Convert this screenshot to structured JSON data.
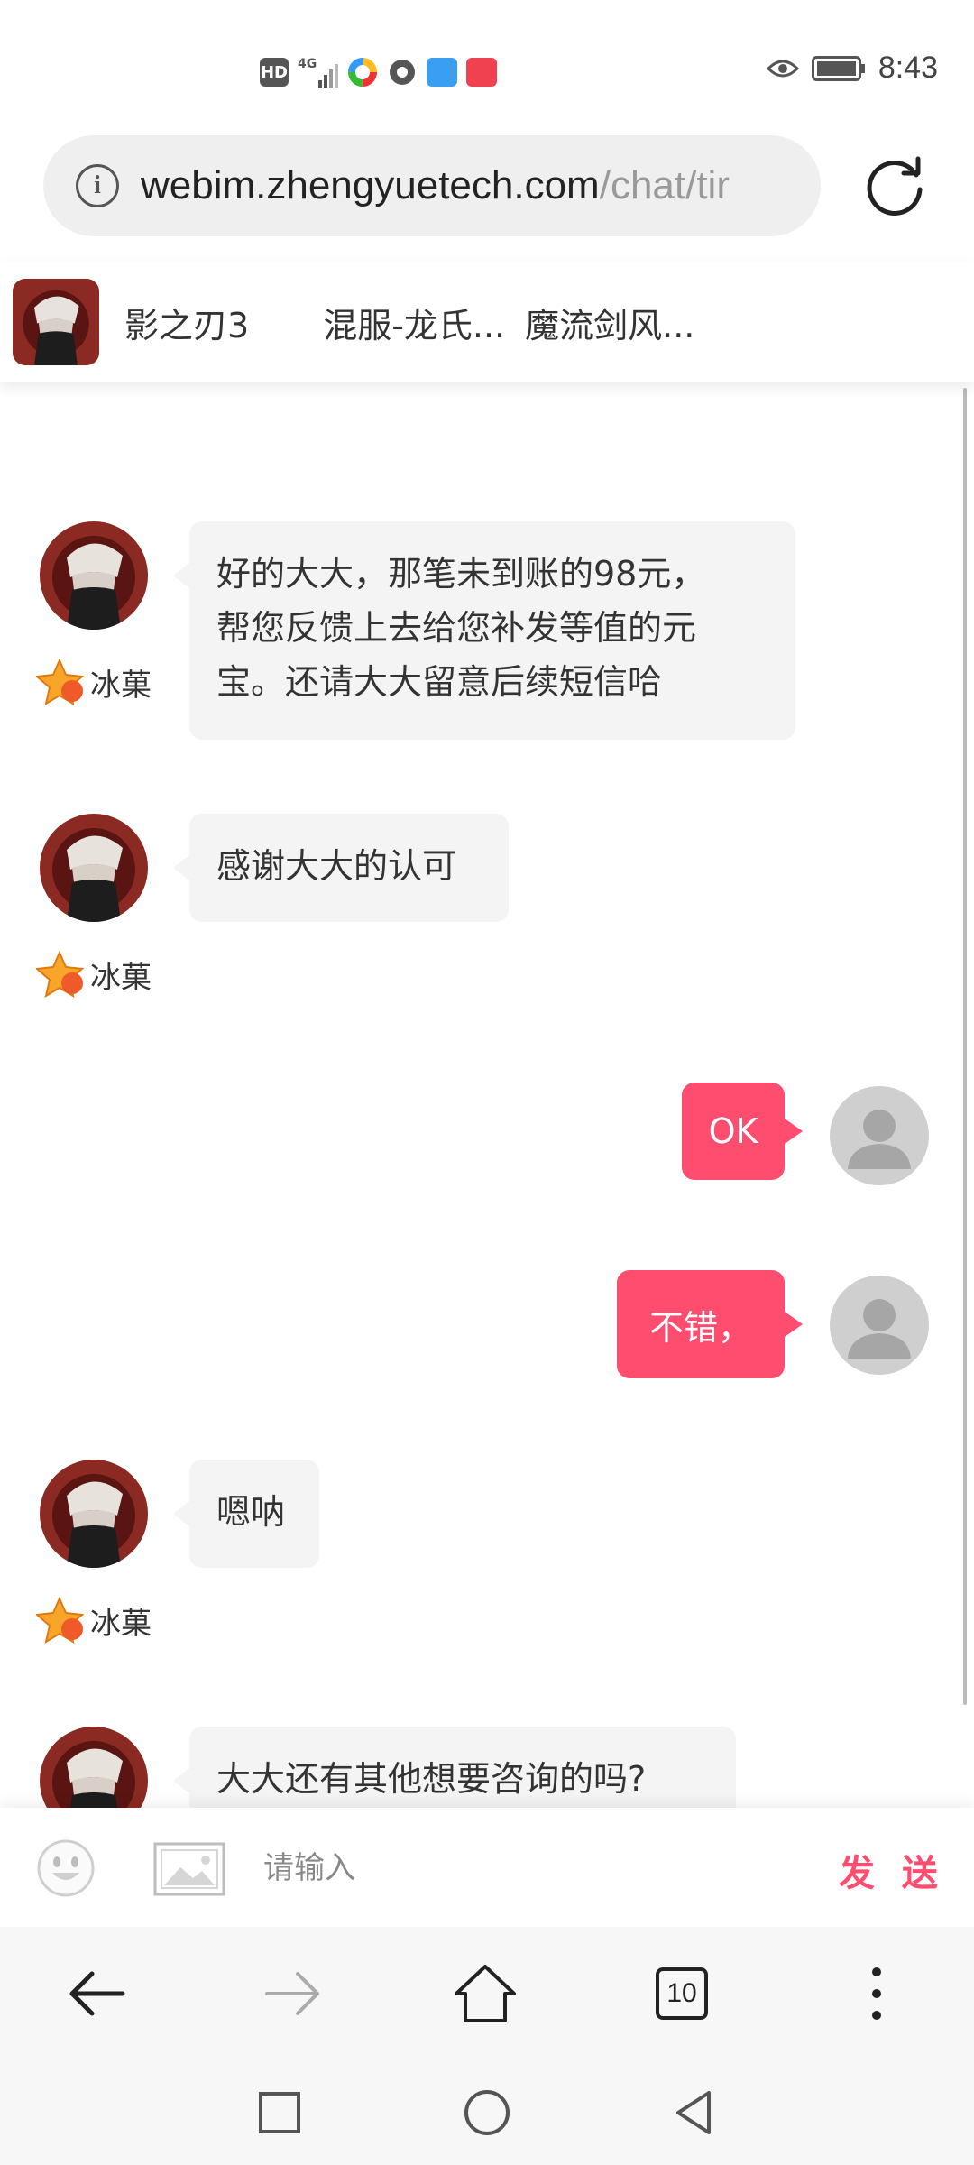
{
  "status_bar": {
    "time": "8:43",
    "chips": [
      "HD",
      "4G"
    ]
  },
  "browser": {
    "url_host": "webim.zhengyuetech.com",
    "url_path": "/chat/tir",
    "info_icon": "i"
  },
  "tabs": [
    {
      "label": "影之刃3"
    },
    {
      "label": "混服-龙氏..."
    },
    {
      "label": "魔流剑风..."
    }
  ],
  "messages": [
    {
      "direction": "in",
      "sender": "冰菓",
      "lines": [
        "好的大大，那笔未到账的98元，",
        "帮您反馈上去给您补发等值的元",
        "宝。还请大大留意后续短信哈"
      ]
    },
    {
      "direction": "in",
      "sender": "冰菓",
      "lines": [
        "感谢大大的认可"
      ]
    },
    {
      "direction": "out",
      "text": "OK"
    },
    {
      "direction": "out",
      "text": "不错，"
    },
    {
      "direction": "in",
      "sender": "冰菓",
      "lines": [
        "嗯呐"
      ]
    },
    {
      "direction": "in",
      "lines": [
        "大大还有其他想要咨询的吗?"
      ]
    }
  ],
  "input": {
    "placeholder": "请输入",
    "send_label": "发 送"
  },
  "browser_nav": {
    "tab_count": "10"
  },
  "colors": {
    "accent": "#ff4d6f",
    "bubble_in": "#f4f4f4",
    "status_text": "#444444"
  }
}
